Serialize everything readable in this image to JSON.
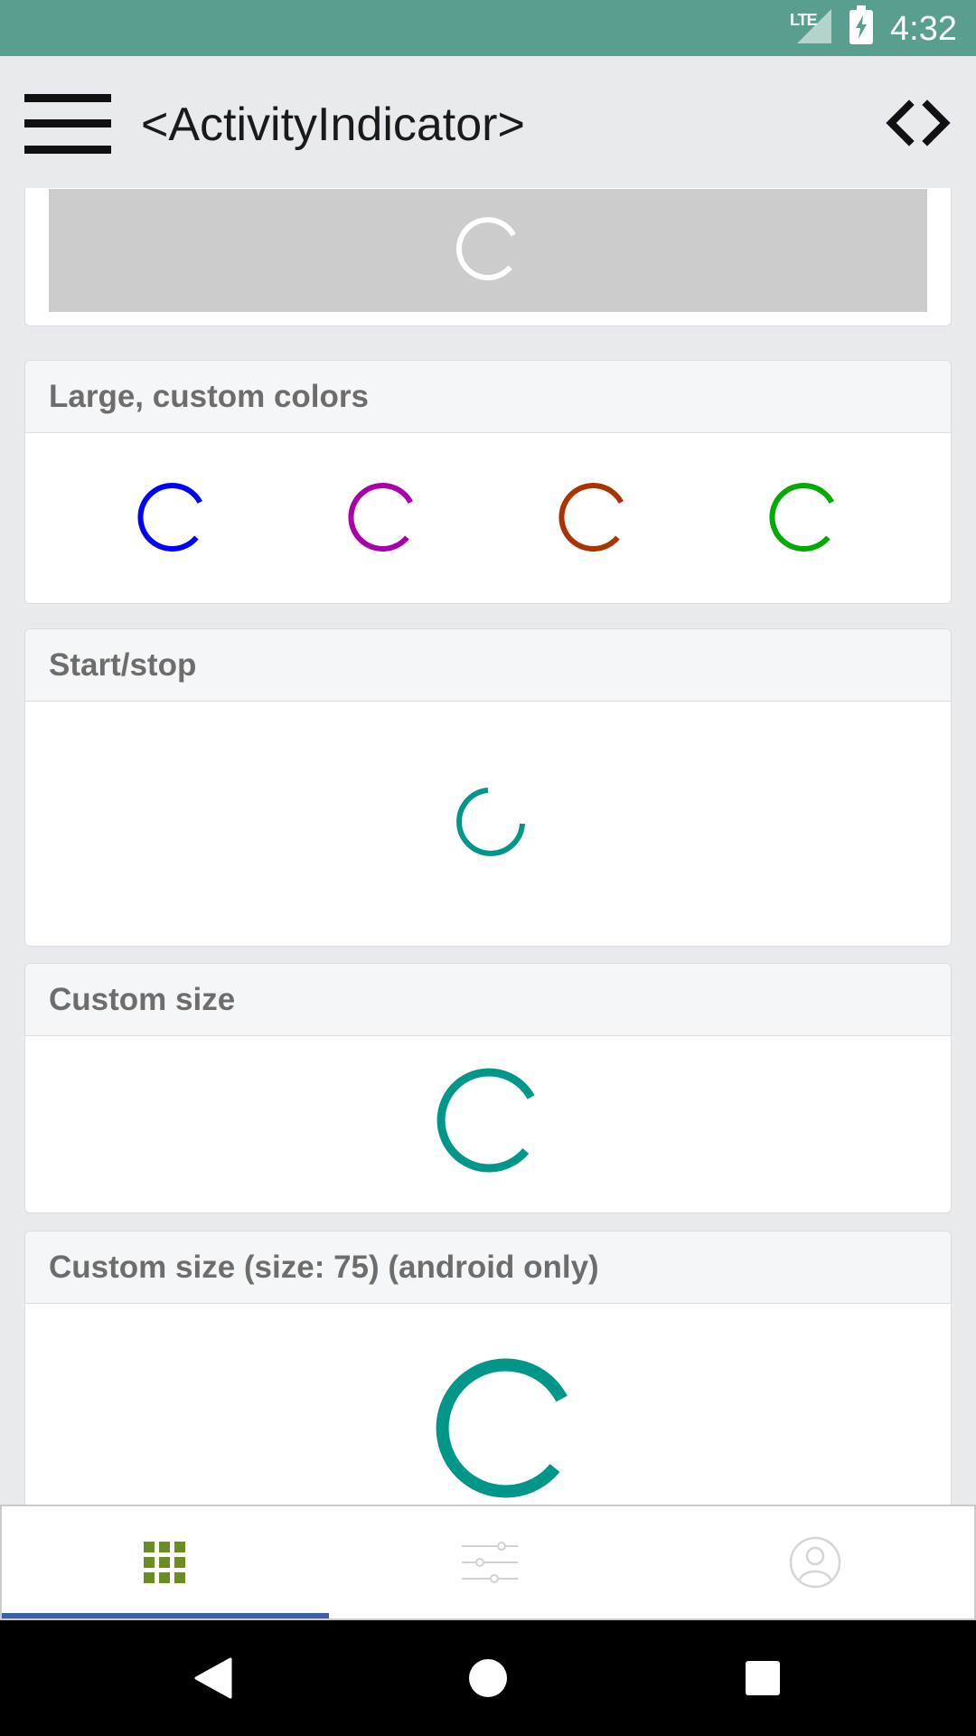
{
  "status_bar": {
    "network": "LTE",
    "time": "4:32"
  },
  "header": {
    "title": "<ActivityIndicator>"
  },
  "sections": [
    {
      "title": ""
    },
    {
      "title": "Large, custom colors",
      "spinner_colors": [
        "#0000ff",
        "#aa00aa",
        "#aa3300",
        "#00aa00"
      ]
    },
    {
      "title": "Start/stop",
      "spinner_color": "#009688"
    },
    {
      "title": "Custom size",
      "spinner_color": "#009688"
    },
    {
      "title": "Custom size (size: 75) (android only)",
      "spinner_color": "#009688"
    }
  ],
  "tabs": [
    {
      "icon": "grid-icon",
      "active": true,
      "color": "#6a8e23"
    },
    {
      "icon": "sliders-icon",
      "active": false
    },
    {
      "icon": "user-icon",
      "active": false
    }
  ],
  "nav": [
    {
      "icon": "back-icon"
    },
    {
      "icon": "home-icon"
    },
    {
      "icon": "recents-icon"
    }
  ]
}
